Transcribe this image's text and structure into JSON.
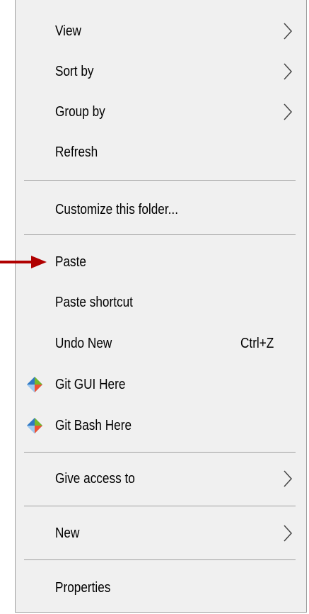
{
  "menu": {
    "items": [
      {
        "label": "View",
        "submenu": true
      },
      {
        "label": "Sort by",
        "submenu": true
      },
      {
        "label": "Group by",
        "submenu": true
      },
      {
        "label": "Refresh"
      },
      {
        "label": "Customize this folder..."
      },
      {
        "label": "Paste"
      },
      {
        "label": "Paste shortcut"
      },
      {
        "label": "Undo New",
        "shortcut": "Ctrl+Z"
      },
      {
        "label": "Git GUI Here",
        "icon": "git-logo-icon"
      },
      {
        "label": "Git Bash Here",
        "icon": "git-logo-icon"
      },
      {
        "label": "Give access to",
        "submenu": true
      },
      {
        "label": "New",
        "submenu": true
      },
      {
        "label": "Properties"
      }
    ]
  },
  "annotation": {
    "pointer_icon": "red-arrow-icon",
    "pointer_color": "#b00000",
    "points_to": "Paste"
  },
  "colors": {
    "menu_background": "#f0f0f0",
    "separator": "#a0a0a0",
    "text": "#000000",
    "git_blue": "#2f78c4",
    "git_orange": "#f05133",
    "git_green": "#76b82a"
  }
}
